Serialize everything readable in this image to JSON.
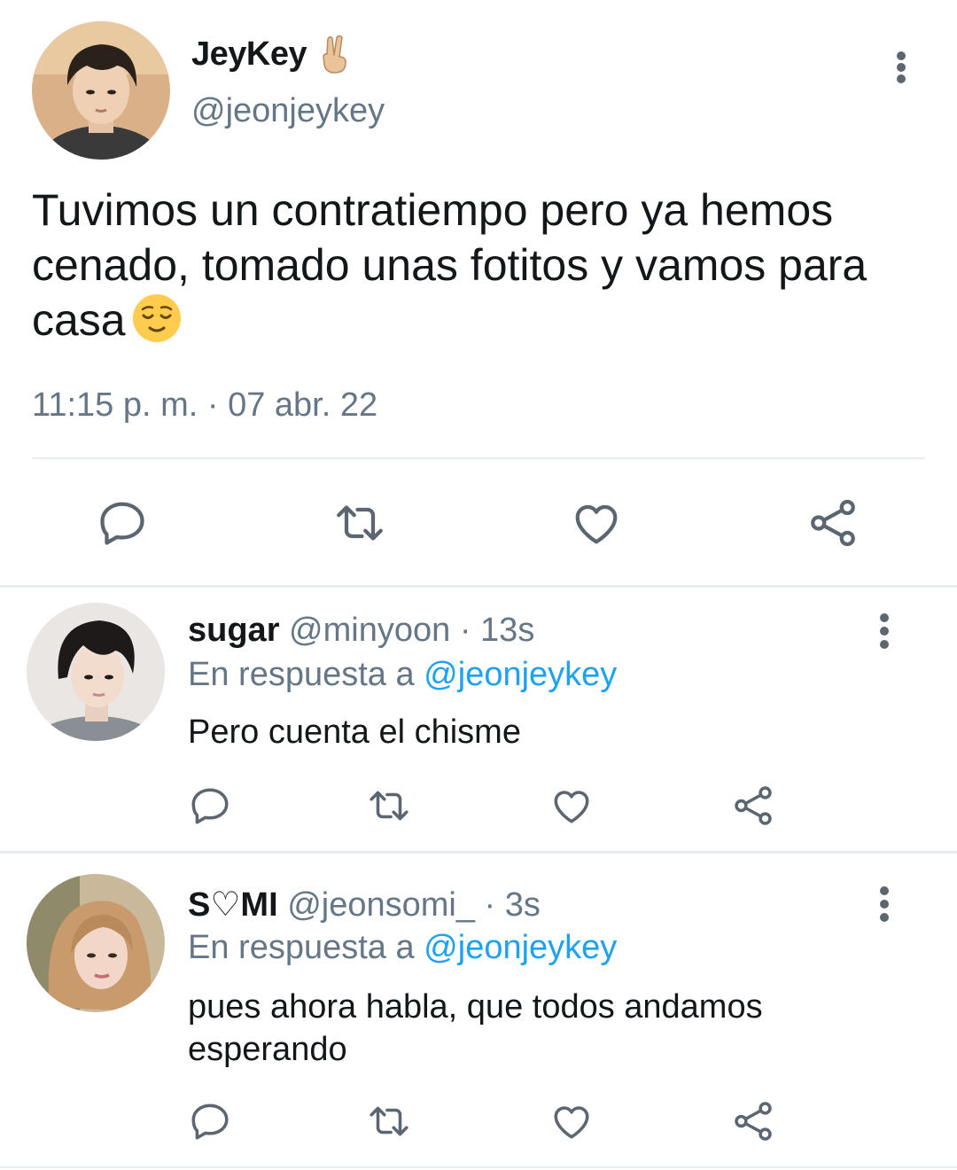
{
  "main_tweet": {
    "display_name": "JeyKey",
    "name_emoji": "victory-hand-emoji",
    "handle": "@jeonjeykey",
    "text": "Tuvimos un contratiempo pero ya hemos cenado, tomado unas fotitos y vamos para casa",
    "text_emoji": "relieved-face-emoji",
    "time": "11:15 p. m.",
    "separator": "·",
    "date": "07 abr. 22",
    "actions": [
      "reply-icon",
      "retweet-icon",
      "like-icon",
      "share-icon"
    ]
  },
  "replies": [
    {
      "display_name": "sugar",
      "handle": "@minyoon",
      "separator": "·",
      "time": "13s",
      "reply_prefix": "En respuesta a",
      "reply_mention": "@jeonjeykey",
      "text": "Pero cuenta el chisme"
    },
    {
      "display_name": "S♡MI",
      "handle": "@jeonsomi_",
      "separator": "·",
      "time": "3s",
      "reply_prefix": "En respuesta a",
      "reply_mention": "@jeonjeykey",
      "text": "pues ahora habla, que todos andamos esperando"
    }
  ],
  "colors": {
    "text": "#14171a",
    "secondary": "#657786",
    "link": "#1da1f2",
    "icon": "#5b6670",
    "divider": "#e6ecf0"
  }
}
